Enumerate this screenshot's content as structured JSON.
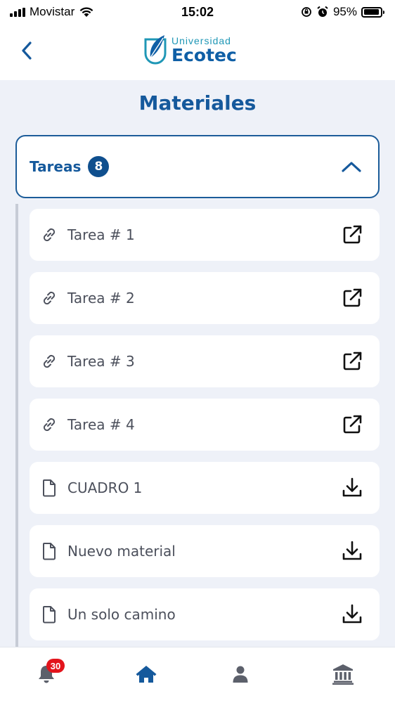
{
  "status_bar": {
    "carrier": "Movistar",
    "time": "15:02",
    "battery": "95%",
    "battery_level": 0.95
  },
  "header": {
    "logo_top": "Universidad",
    "logo_bottom": "Ecotec",
    "back_icon": "chevron-left-icon"
  },
  "page": {
    "title": "Materiales"
  },
  "accordion": {
    "title": "Tareas",
    "count": "8",
    "expanded": true
  },
  "items": [
    {
      "label": "Tarea # 1",
      "type": "link",
      "icon": "link-icon",
      "action": "external-link-icon"
    },
    {
      "label": "Tarea # 2",
      "type": "link",
      "icon": "link-icon",
      "action": "external-link-icon"
    },
    {
      "label": "Tarea # 3",
      "type": "link",
      "icon": "link-icon",
      "action": "external-link-icon"
    },
    {
      "label": "Tarea # 4",
      "type": "link",
      "icon": "link-icon",
      "action": "external-link-icon"
    },
    {
      "label": "CUADRO 1",
      "type": "file",
      "icon": "file-icon",
      "action": "download-icon"
    },
    {
      "label": "Nuevo material",
      "type": "file",
      "icon": "file-icon",
      "action": "download-icon"
    },
    {
      "label": "Un solo camino",
      "type": "file",
      "icon": "file-icon",
      "action": "download-icon"
    }
  ],
  "bottom_nav": {
    "notifications_count": "30",
    "items": [
      "bell-icon",
      "home-icon",
      "user-icon",
      "institution-icon"
    ],
    "active": "home-icon"
  },
  "colors": {
    "primary": "#15599c",
    "badge": "#0f4f8e",
    "notification": "#e3141c",
    "background": "#eef1f8"
  }
}
